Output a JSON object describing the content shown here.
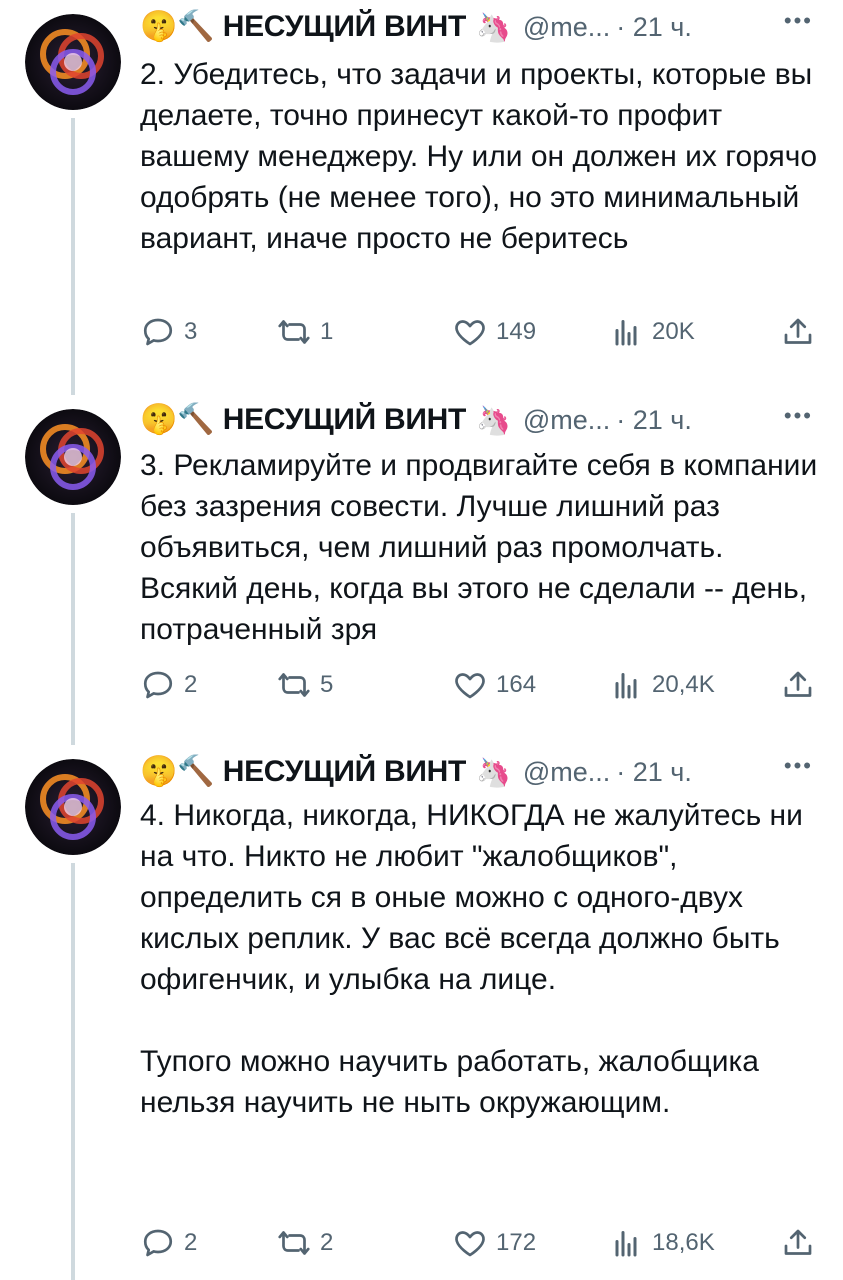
{
  "tweets": [
    {
      "author": {
        "emoji": "🤫🔨",
        "name": "НЕСУЩИЙ ВИНТ",
        "badge_emoji": "🦄",
        "handle": "@me...",
        "time": "· 21 ч."
      },
      "text": "2. Убедитесь, что задачи и проекты, которые вы делаете, точно принесут какой-то профит вашему менеджеру. Ну или он должен их горячо одобрять (не менее того), но это минимальный вариант, иначе просто не беритесь",
      "stats": {
        "replies": "3",
        "retweets": "1",
        "likes": "149",
        "views": "20K"
      }
    },
    {
      "author": {
        "emoji": "🤫🔨",
        "name": "НЕСУЩИЙ ВИНТ",
        "badge_emoji": "🦄",
        "handle": "@me...",
        "time": "· 21 ч."
      },
      "text": "3. Рекламируйте и продвигайте себя в компании без зазрения совести. Лучше лишний раз объявиться, чем лишний раз промолчать. Всякий день, когда вы этого не сделали -- день, потраченный зря",
      "stats": {
        "replies": "2",
        "retweets": "5",
        "likes": "164",
        "views": "20,4K"
      }
    },
    {
      "author": {
        "emoji": "🤫🔨",
        "name": "НЕСУЩИЙ ВИНТ",
        "badge_emoji": "🦄",
        "handle": "@me...",
        "time": "· 21 ч."
      },
      "text": "4. Никогда, никогда, НИКОГДА не жалуйтесь ни на что. Никто не любит \"жалобщиков\", определить ся в оные можно с одного-двух кислых реплик. У вас всё всегда должно быть офигенчик, и улыбка на лице.\n\nТупого можно научить работать, жалобщика нельзя научить не ныть окружающим.",
      "stats": {
        "replies": "2",
        "retweets": "2",
        "likes": "172",
        "views": "18,6K"
      }
    }
  ],
  "icons": {
    "reply": "reply-icon",
    "retweet": "retweet-icon",
    "like": "heart-icon",
    "views": "views-icon",
    "share": "share-icon",
    "more": "more-icon"
  },
  "colors": {
    "text": "#0f1419",
    "secondary": "#536471",
    "thread_line": "#cfd9de"
  }
}
